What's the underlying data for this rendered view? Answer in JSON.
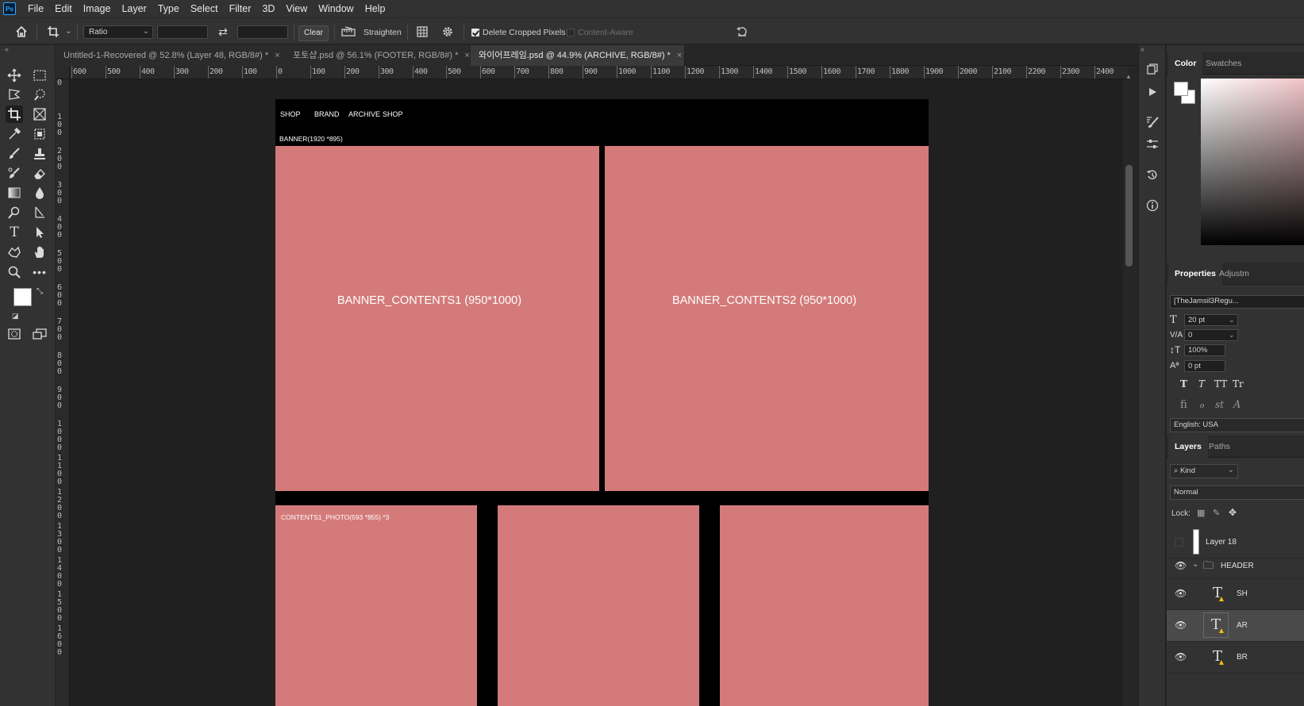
{
  "app": {
    "logo": "Ps"
  },
  "menu": [
    "File",
    "Edit",
    "Image",
    "Layer",
    "Type",
    "Select",
    "Filter",
    "3D",
    "View",
    "Window",
    "Help"
  ],
  "options": {
    "ratio_value": "Ratio",
    "clear_label": "Clear",
    "straighten_label": "Straighten",
    "delete_cropped_label": "Delete Cropped Pixels",
    "delete_cropped_checked": true,
    "content_aware_label": "Content-Aware",
    "content_aware_checked": false
  },
  "tabs": [
    {
      "title": "Untitled-1-Recovered @ 52.8% (Layer 48, RGB/8#) *",
      "close": "×",
      "active": false
    },
    {
      "title": "포토샵.psd @ 56.1% (FOOTER, RGB/8#) *",
      "close": "×",
      "active": false
    },
    {
      "title": "와이어프레임.psd @ 44.9% (ARCHIVE, RGB/8#) *",
      "close": "×",
      "active": true
    }
  ],
  "ruler_top": [
    "600",
    "500",
    "400",
    "300",
    "200",
    "100",
    "0",
    "100",
    "200",
    "300",
    "400",
    "500",
    "600",
    "700",
    "800",
    "900",
    "1000",
    "1100",
    "1200",
    "1300",
    "1400",
    "1500",
    "1600",
    "1700",
    "1800",
    "1900",
    "2000",
    "2100",
    "2200",
    "2300",
    "2400"
  ],
  "ruler_left": [
    "0",
    "100",
    "200",
    "300",
    "400",
    "500",
    "600",
    "700",
    "800",
    "900",
    "1000",
    "1100",
    "1200",
    "1300",
    "1400",
    "1500",
    "1600"
  ],
  "document": {
    "nav": [
      "SHOP",
      "BRAND",
      "ARCHIVE",
      "SHOP"
    ],
    "banner_label": "BANNER(1920 *895)",
    "banner1": "BANNER_CONTENTS1 (950*1000)",
    "banner2": "BANNER_CONTENTS2 (950*1000)",
    "contents_label": "CONTENTS1_PHOTO(593 *855) *3",
    "fill_color": "#d47a7a"
  },
  "panels": {
    "color_tabs": [
      "Color",
      "Swatches"
    ],
    "properties_tabs": [
      "Properties",
      "Adjustm"
    ],
    "font_family": "[TheJamsil3Regu...",
    "font_size": "20 pt",
    "tracking": "0",
    "vertical_scale": "100%",
    "baseline_shift": "0 pt",
    "type_style_buttons": [
      "T",
      "T",
      "TT",
      "Tr"
    ],
    "opentype_glyphs": [
      "ﬁ",
      "ℴ",
      "st",
      "A"
    ],
    "language": "English: USA",
    "layers_tabs": [
      "Layers",
      "Paths"
    ],
    "kind_filter": "Kind",
    "blend_mode": "Normal",
    "lock_label": "Lock:",
    "layers": [
      {
        "name": "Layer 18",
        "visible": false,
        "type": "pixel"
      },
      {
        "name": "HEADER",
        "visible": true,
        "type": "group"
      },
      {
        "name": "SH",
        "visible": true,
        "type": "text"
      },
      {
        "name": "AR",
        "visible": true,
        "type": "text",
        "selected": true
      },
      {
        "name": "BR",
        "visible": true,
        "type": "text"
      }
    ]
  }
}
